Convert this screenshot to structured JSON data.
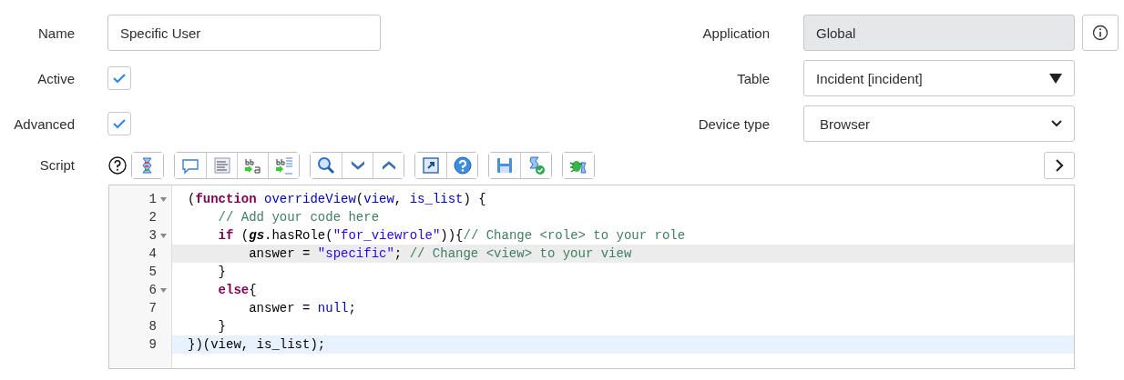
{
  "fields_left": [
    {
      "label": "Name",
      "kind": "text",
      "value": "Specific User"
    },
    {
      "label": "Active",
      "kind": "checkbox",
      "checked": true
    },
    {
      "label": "Advanced",
      "kind": "checkbox",
      "checked": true
    }
  ],
  "fields_right": [
    {
      "label": "Application",
      "kind": "readonly",
      "value": "Global"
    },
    {
      "label": "Table",
      "kind": "reference",
      "value": "Incident [incident]"
    },
    {
      "label": "Device type",
      "kind": "select",
      "value": "Browser"
    }
  ],
  "script": {
    "label": "Script",
    "toolbar_groups": [
      [
        {
          "kind": "script"
        }
      ],
      [
        {
          "kind": "comment"
        },
        {
          "kind": "format"
        },
        {
          "kind": "replace"
        },
        {
          "kind": "replace-all"
        }
      ],
      [
        {
          "kind": "search"
        },
        {
          "kind": "next"
        },
        {
          "kind": "previous"
        }
      ],
      [
        {
          "kind": "fullscreen"
        },
        {
          "kind": "help"
        }
      ],
      [
        {
          "kind": "save"
        },
        {
          "kind": "check"
        }
      ],
      [
        {
          "kind": "debug"
        }
      ]
    ],
    "lines": [
      {
        "number": "1",
        "fold": true,
        "hovered": false,
        "selected": false,
        "tokens": [
          {
            "kind": "plain",
            "text": "("
          },
          {
            "kind": "keyword",
            "text": "function"
          },
          {
            "kind": "name",
            "text": " overrideView"
          },
          {
            "kind": "plain",
            "text": "("
          },
          {
            "kind": "name",
            "text": "view"
          },
          {
            "kind": "plain",
            "text": ", "
          },
          {
            "kind": "name",
            "text": "is_list"
          },
          {
            "kind": "plain",
            "text": ") {"
          }
        ]
      },
      {
        "number": "2",
        "fold": false,
        "hovered": false,
        "selected": false,
        "tokens": [
          {
            "kind": "comment",
            "text": "    // Add your code here"
          }
        ]
      },
      {
        "number": "3",
        "fold": true,
        "hovered": false,
        "selected": false,
        "tokens": [
          {
            "kind": "keyword",
            "text": "    if"
          },
          {
            "kind": "plain",
            "text": " ("
          },
          {
            "kind": "global",
            "text": "gs"
          },
          {
            "kind": "plain",
            "text": ".hasRole("
          },
          {
            "kind": "string",
            "text": "\"for_viewrole\""
          },
          {
            "kind": "plain",
            "text": ")){"
          },
          {
            "kind": "comment",
            "text": "// Change <role> to your role"
          }
        ]
      },
      {
        "number": "4",
        "fold": false,
        "hovered": true,
        "selected": false,
        "tokens": [
          {
            "kind": "plain",
            "text": "        answer = "
          },
          {
            "kind": "string",
            "text": "\"specific\""
          },
          {
            "kind": "plain",
            "text": "; "
          },
          {
            "kind": "comment",
            "text": "// Change <view> to your view"
          }
        ]
      },
      {
        "number": "5",
        "fold": false,
        "hovered": false,
        "selected": false,
        "tokens": [
          {
            "kind": "plain",
            "text": "    }"
          }
        ]
      },
      {
        "number": "6",
        "fold": true,
        "hovered": false,
        "selected": false,
        "tokens": [
          {
            "kind": "keyword",
            "text": "    else"
          },
          {
            "kind": "plain",
            "text": "{"
          }
        ]
      },
      {
        "number": "7",
        "fold": false,
        "hovered": false,
        "selected": false,
        "tokens": [
          {
            "kind": "plain",
            "text": "        answer = "
          },
          {
            "kind": "name",
            "text": "null"
          },
          {
            "kind": "plain",
            "text": ";"
          }
        ]
      },
      {
        "number": "8",
        "fold": false,
        "hovered": false,
        "selected": false,
        "tokens": [
          {
            "kind": "plain",
            "text": "    }"
          }
        ]
      },
      {
        "number": "9",
        "fold": false,
        "hovered": false,
        "selected": true,
        "tokens": [
          {
            "kind": "plain",
            "text": "})(view, is_list);"
          }
        ]
      }
    ]
  }
}
